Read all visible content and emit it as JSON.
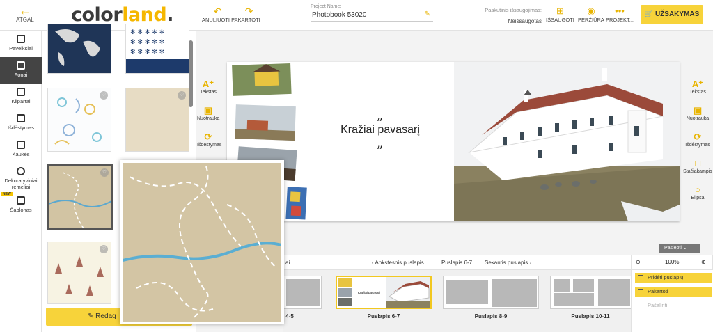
{
  "header": {
    "back_label": "ATGAL",
    "logo": {
      "part1": "color",
      "part2": "land",
      "part3": "."
    },
    "undo_redo_label": "ANULIUOTI PAKARTOTI",
    "project_caption": "Project Name:",
    "project_name": "Photobook 53020",
    "saved_caption": "Paskutinis išsaugojimas:",
    "saved_value": "Neišsaugotas",
    "save_label": "IŠSAUGOTI",
    "preview_label": "PERŽIŪRA",
    "project_label": "PROJEKT...",
    "order_label": "UŽSAKYMAS"
  },
  "left_tools": [
    {
      "label": "Paveikslai"
    },
    {
      "label": "Fonai"
    },
    {
      "label": "Klipartai"
    },
    {
      "label": "Išdėstymas"
    },
    {
      "label": "Kaukės"
    },
    {
      "label": "Dekoratyviniai rėmeliai"
    },
    {
      "label": "Šablonas",
      "badge": "NEW"
    }
  ],
  "panel": {
    "edit_label": "Redag"
  },
  "canvas_tools_left": [
    {
      "label": "Tekstas"
    },
    {
      "label": "Nuotrauka"
    },
    {
      "label": "Išdėstymas"
    }
  ],
  "canvas_tools_right": [
    {
      "label": "Tekstas"
    },
    {
      "label": "Nuotrauka"
    },
    {
      "label": "Išdėstymas"
    },
    {
      "label": "Stačiakampis"
    },
    {
      "label": "Elipsa"
    }
  ],
  "book": {
    "quote_open": "„",
    "quote_text": "Kražiai pavasarį",
    "quote_close": "„"
  },
  "nav": {
    "first_stub": "ai",
    "prev": "Ankstesnis puslapis",
    "current": "Puslapis 6-7",
    "next": "Sekantis puslapis",
    "hide": "Paslėpti",
    "zoom": "100%"
  },
  "spreads": [
    {
      "label": "4-5"
    },
    {
      "label": "Puslapis 6-7"
    },
    {
      "label": "Puslapis 8-9"
    },
    {
      "label": "Puslapis 10-11"
    }
  ],
  "context_menu": {
    "add_page": "Pridėti puslapių",
    "duplicate": "Pakartoti",
    "delete": "Pašalinti"
  },
  "colors": {
    "accent": "#f7d33a",
    "icon": "#e8b400"
  }
}
